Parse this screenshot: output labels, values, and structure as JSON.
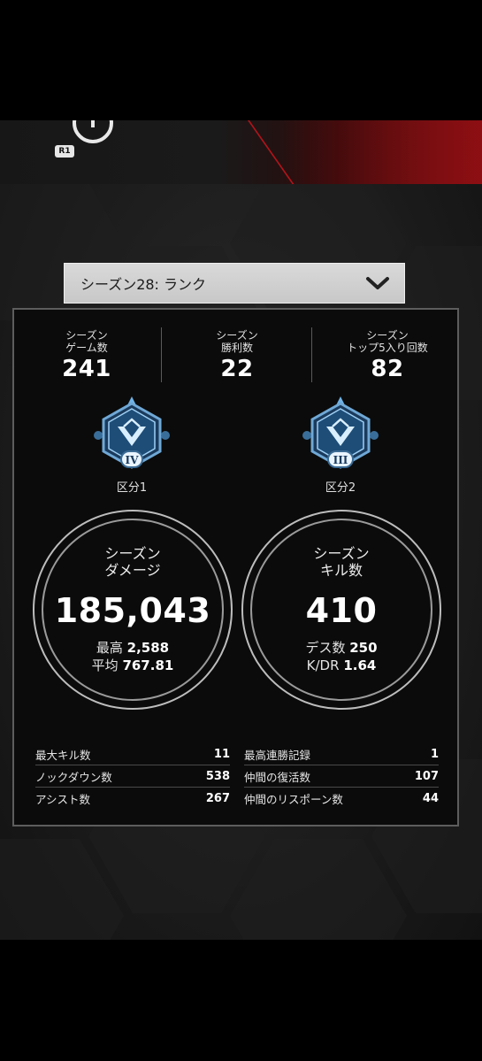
{
  "header": {
    "r1_label": "R1"
  },
  "season_selector": {
    "label": "シーズン28: ランク",
    "icon": "chevron-down-icon"
  },
  "top_stats": [
    {
      "label_line1": "シーズン",
      "label_line2": "ゲーム数",
      "value": "241"
    },
    {
      "label_line1": "シーズン",
      "label_line2": "勝利数",
      "value": "22"
    },
    {
      "label_line1": "シーズン",
      "label_line2": "トップ5入り回数",
      "value": "82"
    }
  ],
  "ranks": [
    {
      "numeral": "IV",
      "division": "区分1",
      "icon": "rank-emblem-icon"
    },
    {
      "numeral": "III",
      "division": "区分2",
      "icon": "rank-emblem-icon"
    }
  ],
  "damage": {
    "title_line1": "シーズン",
    "title_line2": "ダメージ",
    "value": "185,043",
    "best_label": "最高",
    "best_value": "2,588",
    "avg_label": "平均",
    "avg_value": "767.81"
  },
  "kills": {
    "title_line1": "シーズン",
    "title_line2": "キル数",
    "value": "410",
    "deaths_label": "デス数",
    "deaths_value": "250",
    "kdr_label": "K/DR",
    "kdr_value": "1.64"
  },
  "details_left": [
    {
      "label": "最大キル数",
      "value": "11"
    },
    {
      "label": "ノックダウン数",
      "value": "538"
    },
    {
      "label": "アシスト数",
      "value": "267"
    }
  ],
  "details_right": [
    {
      "label": "最高連勝記録",
      "value": "1"
    },
    {
      "label": "仲間の復活数",
      "value": "107"
    },
    {
      "label": "仲間のリスポーン数",
      "value": "44"
    }
  ],
  "colors": {
    "accent_red": "#b0141b",
    "card_bg": "#0b0b0b",
    "emblem_blue": "#4f9ad6"
  }
}
